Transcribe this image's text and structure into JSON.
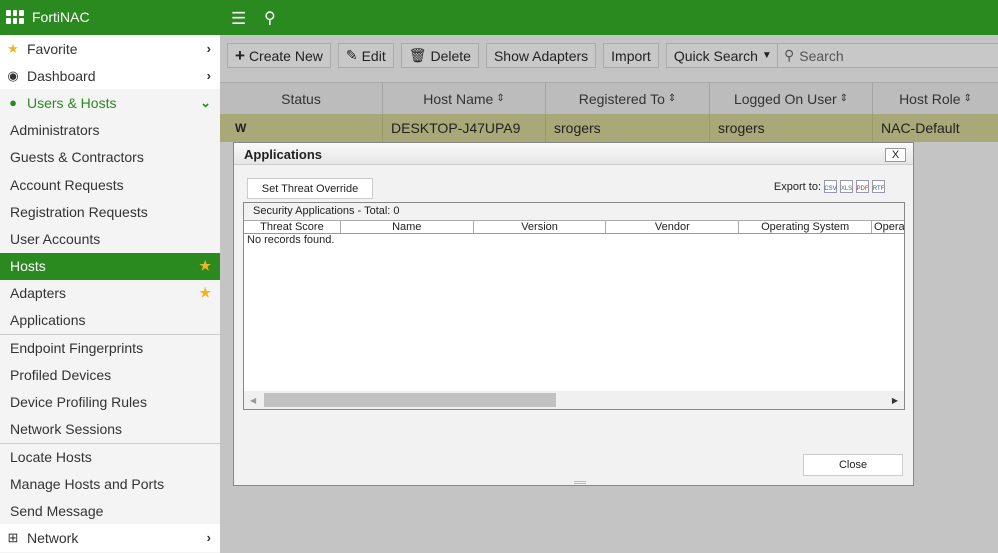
{
  "topbar": {
    "brand": "FortiNAC"
  },
  "sidebar": {
    "items": [
      {
        "label": "Favorite"
      },
      {
        "label": "Dashboard"
      },
      {
        "label": "Users & Hosts"
      },
      {
        "label": "Administrators"
      },
      {
        "label": "Guests & Contractors"
      },
      {
        "label": "Account Requests"
      },
      {
        "label": "Registration Requests"
      },
      {
        "label": "User Accounts"
      },
      {
        "label": "Hosts"
      },
      {
        "label": "Adapters"
      },
      {
        "label": "Applications"
      },
      {
        "label": "Endpoint Fingerprints"
      },
      {
        "label": "Profiled Devices"
      },
      {
        "label": "Device Profiling Rules"
      },
      {
        "label": "Network Sessions"
      },
      {
        "label": "Locate Hosts"
      },
      {
        "label": "Manage Hosts and Ports"
      },
      {
        "label": "Send Message"
      },
      {
        "label": "Network"
      }
    ]
  },
  "toolbar": {
    "create": "Create New",
    "edit": "Edit",
    "delete": "Delete",
    "show_adapters": "Show Adapters",
    "import": "Import",
    "quick_search": "Quick Search",
    "search_placeholder": "Search"
  },
  "table": {
    "headers": [
      "Status",
      "Host Name",
      "Registered To",
      "Logged On User",
      "Host Role"
    ],
    "rows": [
      [
        "W",
        "DESKTOP-J47UPA9",
        "srogers",
        "srogers",
        "NAC-Default"
      ]
    ]
  },
  "dialog": {
    "title": "Applications",
    "close_x": "X",
    "set_threat": "Set Threat Override",
    "export_label": "Export to:",
    "export_formats": [
      "CSV",
      "XLS",
      "PDF",
      "RTF"
    ],
    "caption": "Security Applications - Total: 0",
    "columns": [
      "Threat Score",
      "Name",
      "Version",
      "Vendor",
      "Operating System",
      "Opera"
    ],
    "empty": "No records found.",
    "close": "Close"
  },
  "colors": {
    "brand": "#2a8a1f",
    "selected_row": "#a8a878",
    "star": "#f0b429"
  }
}
